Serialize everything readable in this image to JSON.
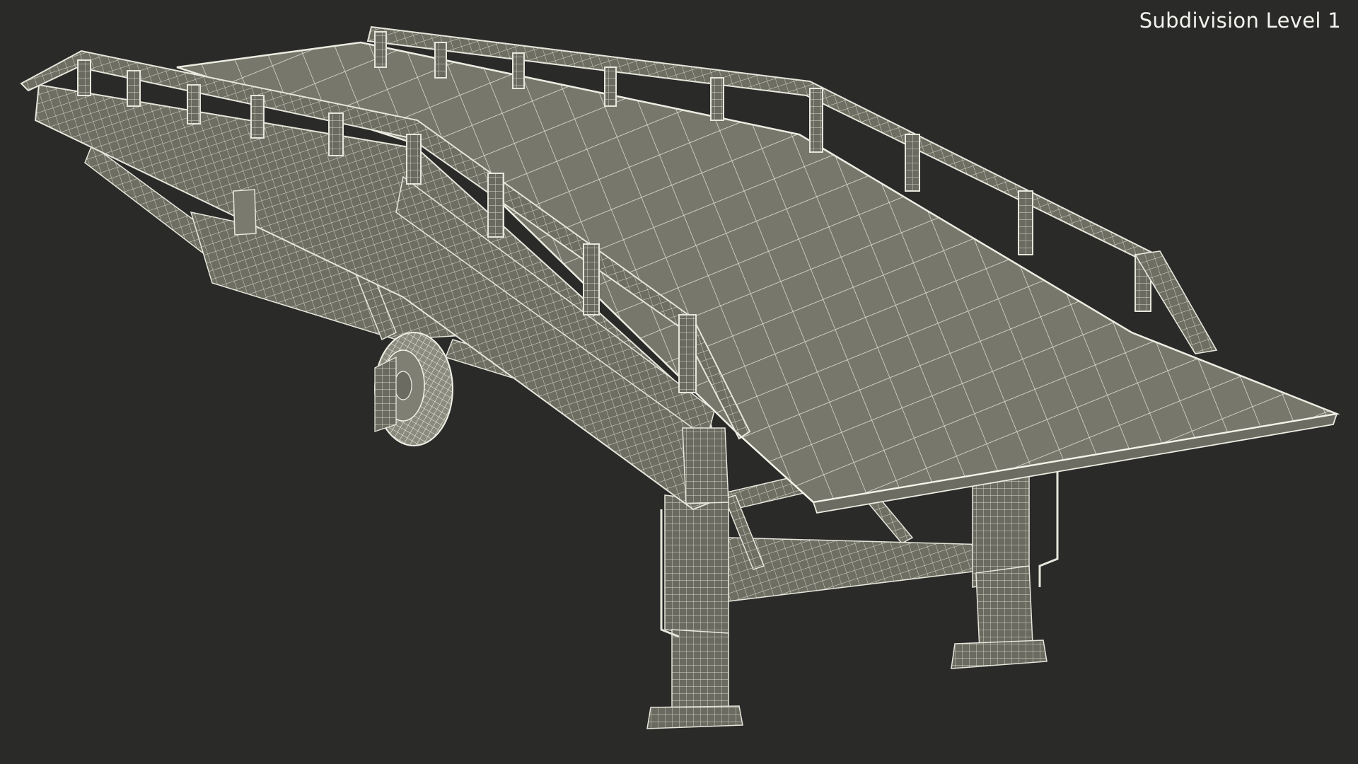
{
  "viewport": {
    "label": "Subdivision Level 1"
  },
  "colors": {
    "background": "#2a2a29",
    "surface": "#76766a",
    "surface_dark": "#5f5f55",
    "wire": "#e9e9df",
    "label": "#f2f2ee"
  }
}
